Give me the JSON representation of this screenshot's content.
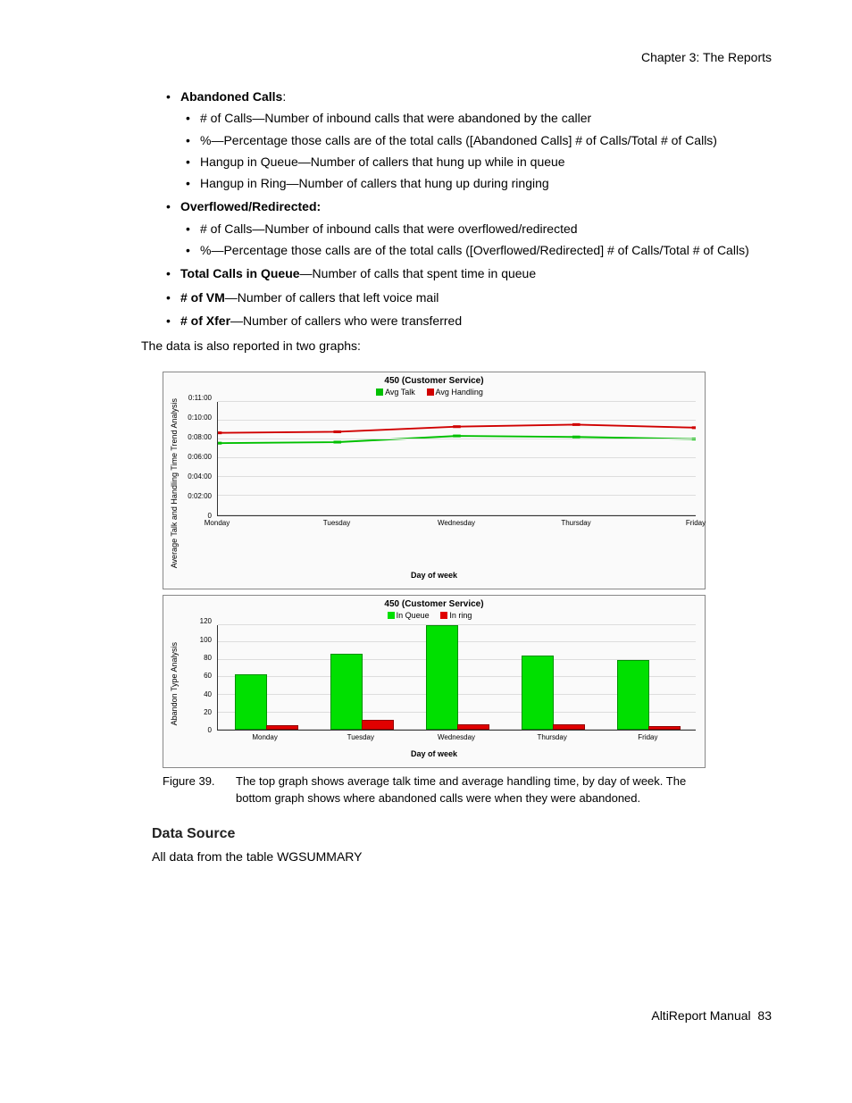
{
  "header": {
    "chapter": "Chapter 3:  The Reports"
  },
  "bullets": {
    "abandoned": {
      "title": "Abandoned Calls",
      "colon": ":",
      "items": [
        "# of Calls—Number of inbound calls that were abandoned by the caller",
        "%—Percentage those calls are of the total calls ([Abandoned Calls] # of Calls/Total # of Calls)",
        "Hangup in Queue—Number of callers that hung up while in queue",
        "Hangup in Ring—Number of callers that hung up during ringing"
      ]
    },
    "overflowed": {
      "title": "Overflowed/Redirected:",
      "items": [
        "# of Calls—Number of inbound calls that were overflowed/redirected",
        "%—Percentage those calls are of the total calls ([Overflowed/Redirected] # of Calls/Total # of Calls)"
      ]
    },
    "totalQueue": {
      "title": "Total Calls in Queue",
      "rest": "—Number of calls that spent time in queue"
    },
    "vm": {
      "title": "# of VM",
      "rest": "—Number of callers that left voice mail"
    },
    "xfer": {
      "title": "# of Xfer",
      "rest": "—Number of callers who were transferred"
    }
  },
  "intro": "The data is also reported in two graphs:",
  "chart_data": [
    {
      "type": "line",
      "title": "450 (Customer Service)",
      "legend": [
        {
          "name": "Avg Talk",
          "color": "#00c000"
        },
        {
          "name": "Avg Handling",
          "color": "#d00000"
        }
      ],
      "ylabel": "Average Talk and Handling Time Trend Analysis",
      "xlabel": "Day of week",
      "categories": [
        "Monday",
        "Tuesday",
        "Wednesday",
        "Thursday",
        "Friday"
      ],
      "yticks": [
        "0",
        "0:02:00",
        "0:04:00",
        "0:06:00",
        "0:08:00",
        "0:10:00",
        "0:11:00"
      ],
      "ylim": [
        0,
        11
      ],
      "series": [
        {
          "name": "Avg Talk",
          "values": [
            7.0,
            7.1,
            7.7,
            7.6,
            7.4
          ]
        },
        {
          "name": "Avg Handling",
          "values": [
            8.0,
            8.1,
            8.6,
            8.8,
            8.5
          ]
        }
      ]
    },
    {
      "type": "bar",
      "title": "450 (Customer Service)",
      "legend": [
        {
          "name": "In Queue",
          "color": "#00e000"
        },
        {
          "name": "In ring",
          "color": "#e00000"
        }
      ],
      "ylabel": "Abandon Type Analysis",
      "xlabel": "Day of week",
      "categories": [
        "Monday",
        "Tuesday",
        "Wednesday",
        "Thursday",
        "Friday"
      ],
      "yticks": [
        "0",
        "20",
        "40",
        "60",
        "80",
        "100",
        "120"
      ],
      "ylim": [
        0,
        120
      ],
      "series": [
        {
          "name": "In Queue",
          "values": [
            62,
            85,
            118,
            83,
            78
          ]
        },
        {
          "name": "In ring",
          "values": [
            3,
            9,
            4,
            4,
            2
          ]
        }
      ]
    }
  ],
  "caption": {
    "label": "Figure 39.",
    "text": "The top graph shows average talk time and average handling time, by day of week. The bottom graph shows where abandoned calls were when they were abandoned."
  },
  "data_source": {
    "heading": "Data Source",
    "body": "All data from the table WGSUMMARY"
  },
  "footer": {
    "manual": "AltiReport Manual",
    "page": "83"
  }
}
